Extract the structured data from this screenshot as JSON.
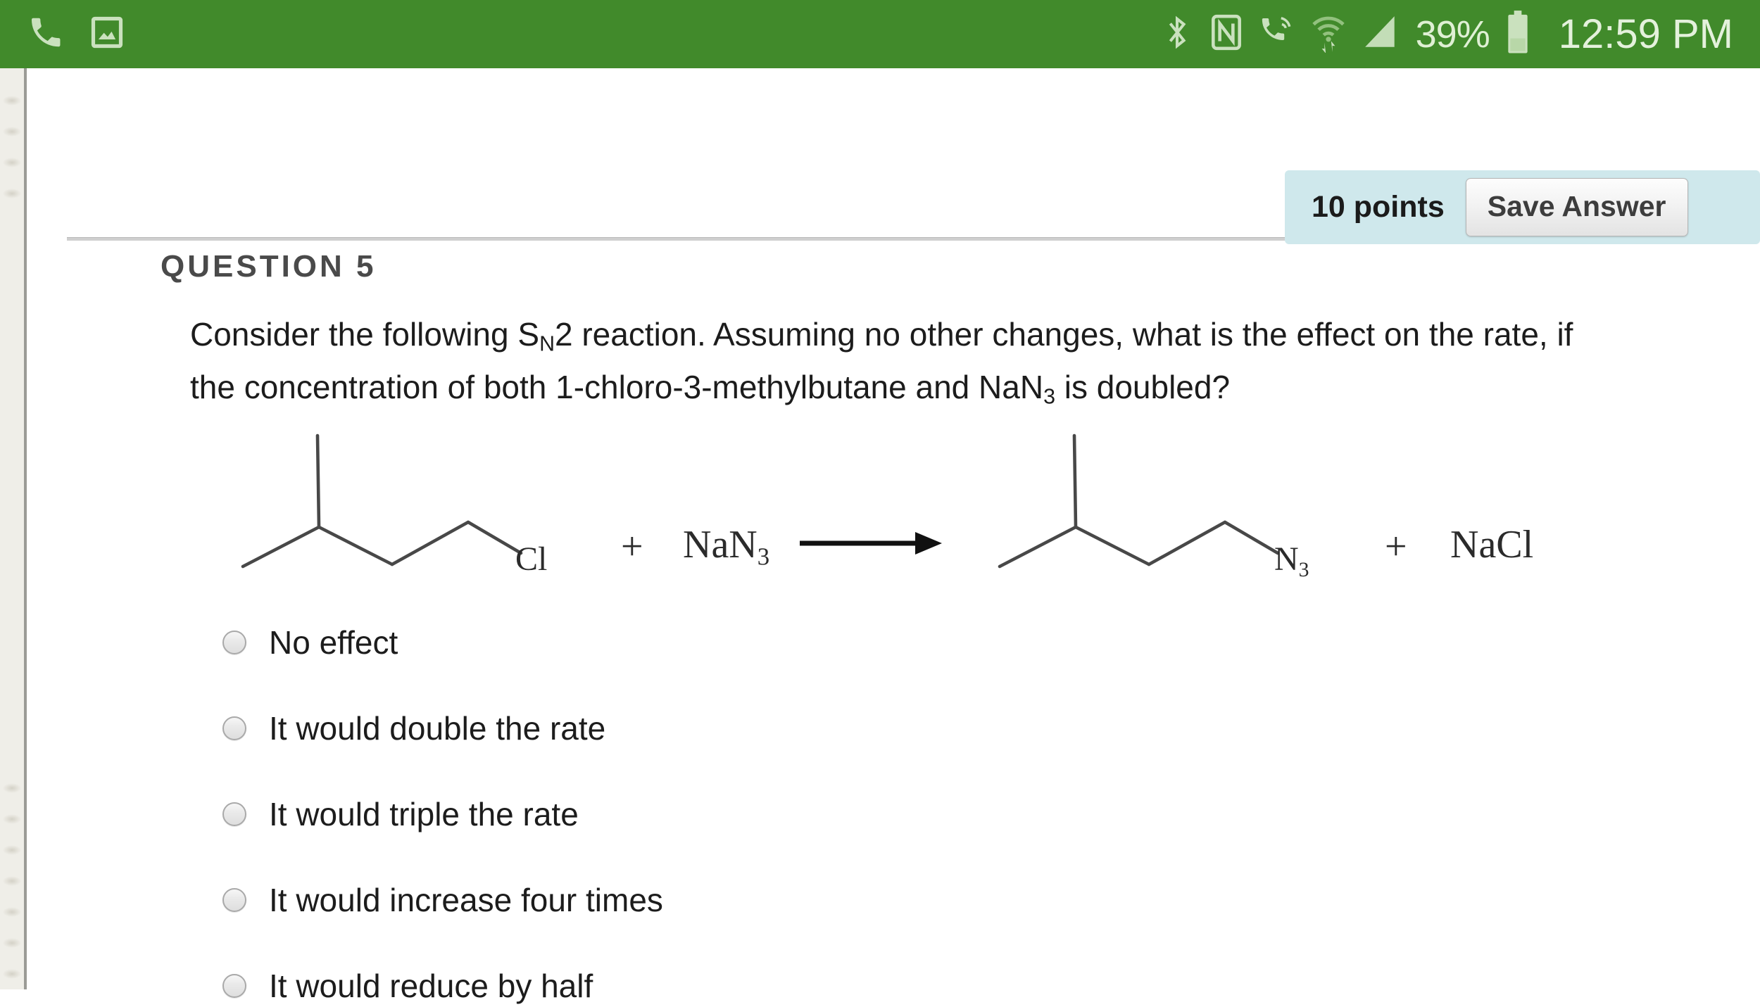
{
  "status_bar": {
    "background_color": "#418a2b",
    "left_icons": [
      {
        "name": "phone-call-icon",
        "label": "call"
      },
      {
        "name": "screenshot-image-icon",
        "label": "screenshot"
      }
    ],
    "right_icons": [
      {
        "name": "bluetooth-icon",
        "label": "bluetooth"
      },
      {
        "name": "nfc-icon",
        "label": "nfc"
      },
      {
        "name": "call-volume-icon",
        "label": "call volume"
      },
      {
        "name": "wifi-transfer-icon",
        "label": "wifi"
      },
      {
        "name": "cellular-signal-icon",
        "label": "signal"
      },
      {
        "name": "battery-icon",
        "label": "battery"
      }
    ],
    "battery_percent": "39%",
    "clock": "12:59 PM"
  },
  "question": {
    "title": "QUESTION 5",
    "points_label": "10 points",
    "save_button_label": "Save Answer",
    "points_panel_color": "#cfe8ec",
    "text_part1": "Consider the following S",
    "text_sub": "N",
    "text_part2": "2 reaction. Assuming no other changes, what is the effect on the rate, if the concentration of both 1-chloro-3-methylbutane and NaN",
    "text_sub2": "3",
    "text_part3": " is doubled?"
  },
  "reaction": {
    "reactant_name": "1-chloro-3-methylbutane",
    "reactant_leaving_group": "Cl",
    "plus_sign_1": "+",
    "reagent": "NaN",
    "reagent_sub": "3",
    "arrow": "reaction-arrow",
    "product_group": "N",
    "product_group_sub": "3",
    "plus_sign_2": "+",
    "byproduct": "NaCl"
  },
  "options": [
    {
      "id": "opt-1",
      "label": "No effect",
      "selected": false
    },
    {
      "id": "opt-2",
      "label": "It would double the rate",
      "selected": false
    },
    {
      "id": "opt-3",
      "label": "It would triple the rate",
      "selected": false
    },
    {
      "id": "opt-4",
      "label": "It would increase four times",
      "selected": false
    },
    {
      "id": "opt-5",
      "label": "It would reduce by half",
      "selected": false
    }
  ]
}
